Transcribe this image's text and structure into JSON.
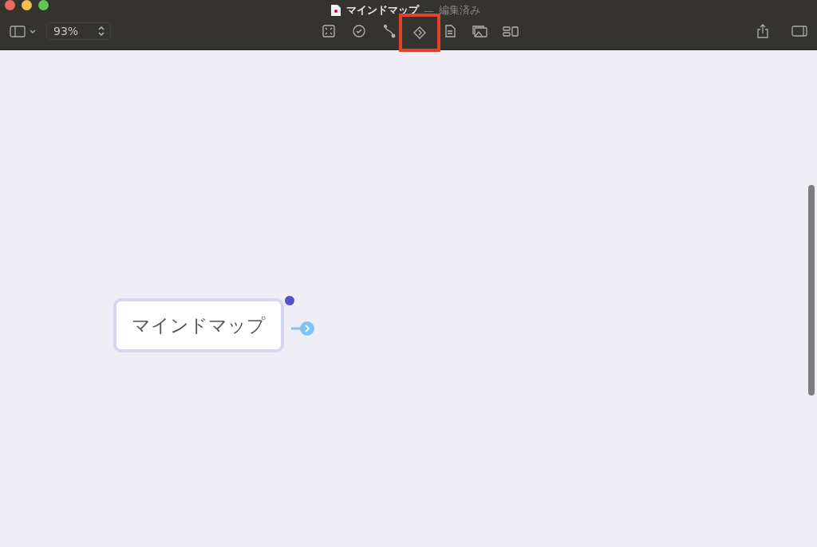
{
  "window": {
    "title": "マインドマップ",
    "separator": "—",
    "subtitle": "編集済み"
  },
  "toolbar": {
    "zoom": "93%",
    "tools": [
      {
        "kind": "fit",
        "highlighted": false
      },
      {
        "kind": "task",
        "highlighted": false
      },
      {
        "kind": "relation",
        "highlighted": false
      },
      {
        "kind": "tag",
        "highlighted": true
      },
      {
        "kind": "note",
        "highlighted": false
      },
      {
        "kind": "image",
        "highlighted": false
      },
      {
        "kind": "layout",
        "highlighted": false
      }
    ]
  },
  "canvas": {
    "nodes": [
      {
        "label": "マインドマップ",
        "selected": true,
        "collapsed": true
      }
    ]
  }
}
